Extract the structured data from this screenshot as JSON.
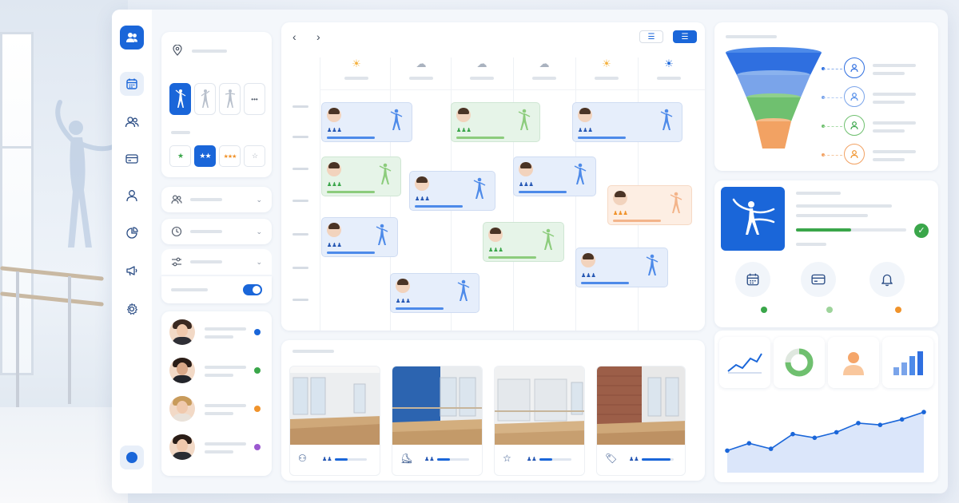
{
  "sidebar": {
    "icons": [
      "team-icon",
      "calendar-icon",
      "members-icon",
      "payments-icon",
      "profile-icon",
      "reports-icon",
      "marketing-icon",
      "settings-icon"
    ]
  },
  "filters": {
    "dance_styles_selected": 0,
    "ratings": [
      "★",
      "★★",
      "★★★",
      "☆"
    ],
    "more_label": "•••",
    "rows": [
      "members-icon",
      "clock-icon",
      "sliders-icon"
    ],
    "toggle_on": true
  },
  "instructors": [
    {
      "status_color": "#1a66d9"
    },
    {
      "status_color": "#3aa64a"
    },
    {
      "status_color": "#f0932b"
    },
    {
      "status_color": "#9b59d0"
    }
  ],
  "calendar": {
    "prev_label": "‹",
    "next_label": "›",
    "weather": [
      "☀",
      "☁",
      "☁",
      "☁",
      "☀",
      "☀"
    ],
    "events": [
      {
        "day": 0,
        "color": "blue"
      },
      {
        "day": 2,
        "color": "green"
      },
      {
        "day": 4,
        "color": "blue"
      },
      {
        "day": 0,
        "color": "green"
      },
      {
        "day": 1,
        "color": "blue"
      },
      {
        "day": 3,
        "color": "blue"
      },
      {
        "day": 5,
        "color": "orange"
      },
      {
        "day": 0,
        "color": "blue"
      },
      {
        "day": 2,
        "color": "green"
      },
      {
        "day": 4,
        "color": "blue"
      },
      {
        "day": 1,
        "color": "blue"
      }
    ],
    "people_glyph": "♟♟♟"
  },
  "studios": [
    {
      "icon": "group-icon",
      "people_glyph": "♟♟"
    },
    {
      "icon": "shoe-icon",
      "people_glyph": "♟♟"
    },
    {
      "icon": "star-icon",
      "people_glyph": "♟♟"
    },
    {
      "icon": "ticket-icon",
      "people_glyph": "♟♟"
    }
  ],
  "funnel": {
    "stages": [
      {
        "color": "#2f6fe0"
      },
      {
        "color": "#7aa4ea"
      },
      {
        "color": "#6fc06f"
      },
      {
        "color": "#f2a263"
      }
    ]
  },
  "member_card": {
    "verified": true,
    "progress": 0.5,
    "actions": [
      {
        "icon": "calendar-icon",
        "dot": "#3aa64a"
      },
      {
        "icon": "card-icon",
        "dot": "#9ed49b"
      },
      {
        "icon": "bell-icon",
        "dot": "#f0932b"
      }
    ]
  },
  "chart_data": {
    "type": "area",
    "x": [
      1,
      2,
      3,
      4,
      5,
      6,
      7,
      8,
      9,
      10
    ],
    "series": [
      {
        "values": [
          12,
          16,
          13,
          21,
          19,
          22,
          27,
          26,
          29,
          33
        ]
      }
    ],
    "ylim": [
      0,
      40
    ]
  },
  "colors": {
    "accent": "#1a66d9",
    "green": "#3aa64a",
    "orange": "#f0932b"
  }
}
